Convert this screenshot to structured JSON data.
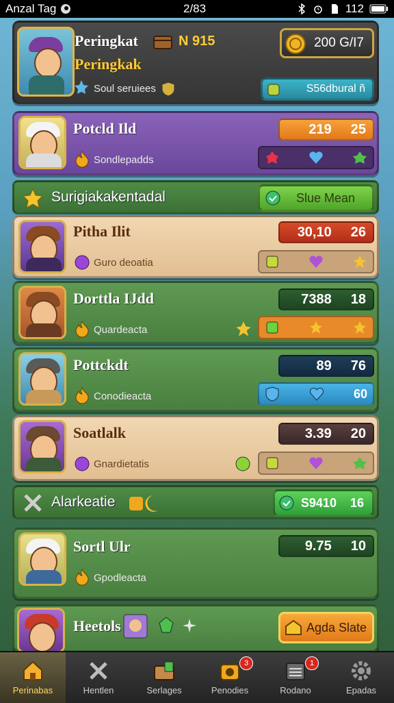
{
  "status_bar": {
    "carrier": "Anzal Tag",
    "time": "2/83",
    "battery": "112"
  },
  "profile": {
    "title": "Peringkat",
    "subtitle": "Peringkak",
    "level": "915",
    "level_prefix": "N",
    "tag": "Soul seruiees",
    "coins": "200 G/I7",
    "button_label": "S56dbural ñ"
  },
  "entries": [
    {
      "name": "Potcld Ild",
      "sub": "Sondlepadds",
      "score_a": "219",
      "score_b": "25",
      "style": "purple"
    },
    {
      "name": "Pitha Ilit",
      "sub": "Guro deoatia",
      "score_a": "30,10",
      "score_b": "26",
      "style": "beige"
    },
    {
      "name": "Dorttla IJdd",
      "sub": "Quardeacta",
      "score_a": "7388",
      "score_b": "18",
      "style": "green"
    },
    {
      "name": "Pottckdt",
      "sub": "Conodieacta",
      "score_a": "89",
      "score_b": "76",
      "score_c": "60",
      "style": "green"
    },
    {
      "name": "Soatlalk",
      "sub": "Gnardietatis",
      "score_a": "3.39",
      "score_b": "20",
      "style": "beige"
    },
    {
      "name": "Sortl Ulr",
      "sub": "Gpodleacta",
      "score_a": "9.75",
      "score_b": "10",
      "style": "green"
    }
  ],
  "section_1": {
    "title": "Surigiakakentadal",
    "button": "Slue Mean"
  },
  "section_2": {
    "title": "Alarkeatie",
    "button_a": "S9410",
    "button_b": "16"
  },
  "bottom_entry": {
    "name": "Heetols",
    "button": "Agda Slate"
  },
  "nav": [
    {
      "label": "Perinabas",
      "icon": "home-icon",
      "badge": ""
    },
    {
      "label": "Hentlen",
      "icon": "sword-icon",
      "badge": ""
    },
    {
      "label": "Serlages",
      "icon": "chest-icon",
      "badge": ""
    },
    {
      "label": "Penodies",
      "icon": "gift-icon",
      "badge": "3"
    },
    {
      "label": "Rodano",
      "icon": "calendar-icon",
      "badge": "1"
    },
    {
      "label": "Epadas",
      "icon": "gear-icon",
      "badge": ""
    }
  ]
}
